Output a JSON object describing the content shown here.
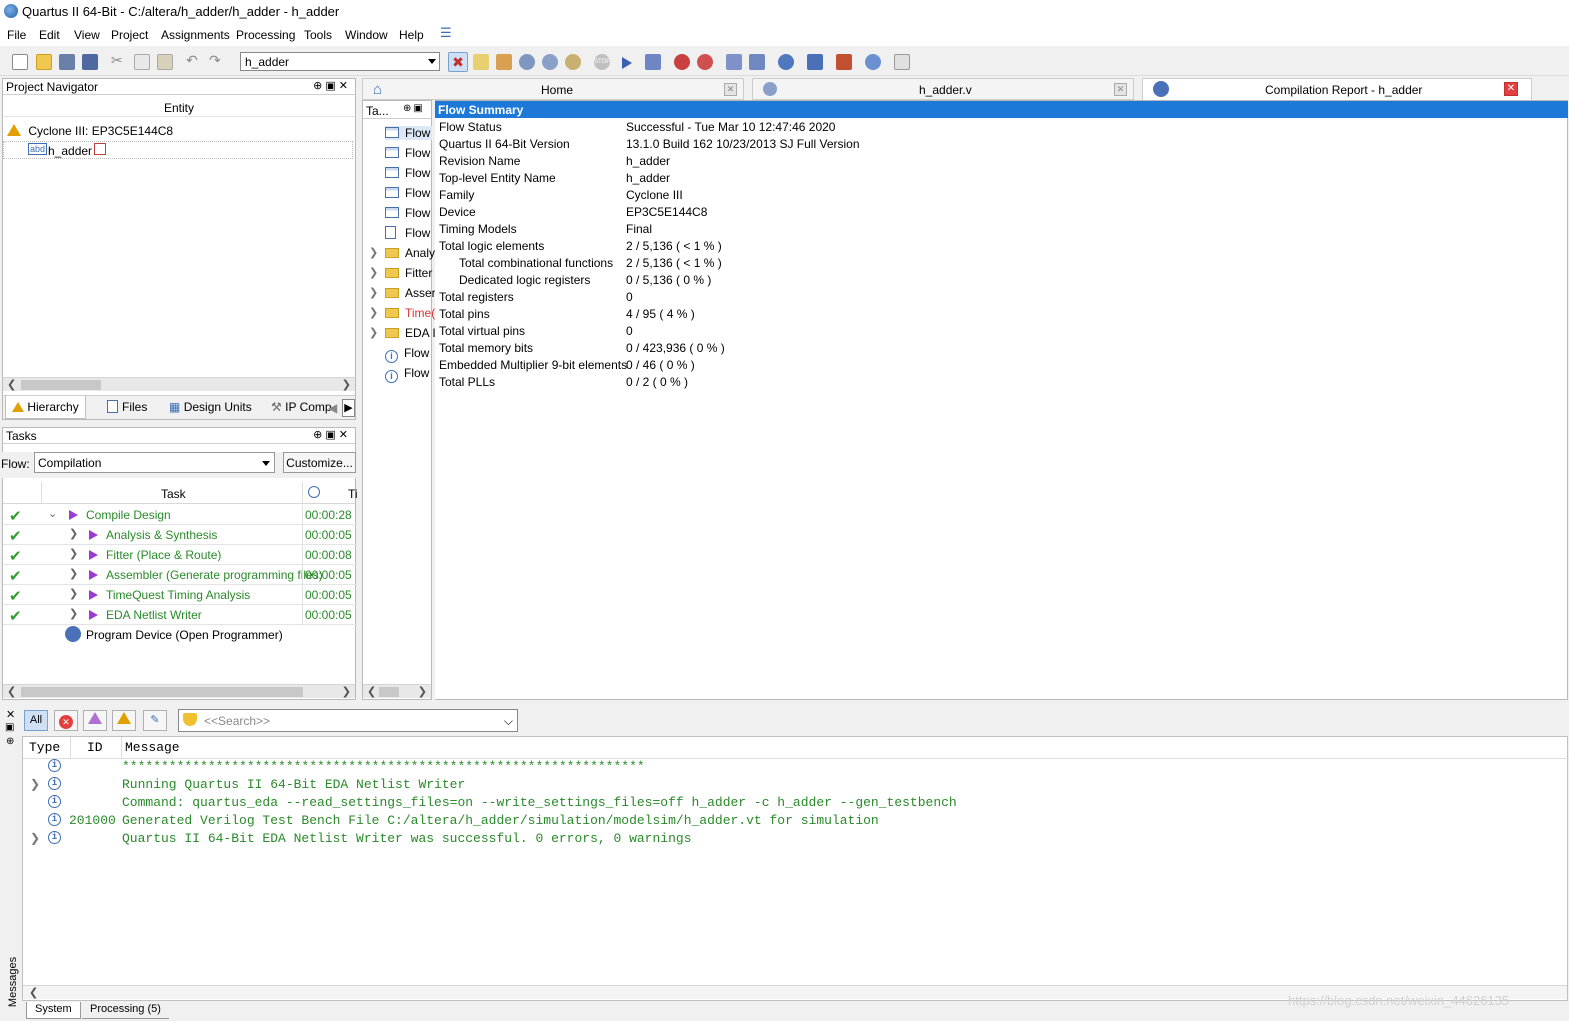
{
  "window": {
    "title": "Quartus II 64-Bit - C:/altera/h_adder/h_adder - h_adder"
  },
  "menu": [
    "File",
    "Edit",
    "View",
    "Project",
    "Assignments",
    "Processing",
    "Tools",
    "Window",
    "Help"
  ],
  "toolbar": {
    "project_select": "h_adder"
  },
  "project_navigator": {
    "title": "Project Navigator",
    "column": "Entity",
    "device": "Cyclone III: EP3C5E144C8",
    "entity": "h_adder",
    "tabs": [
      "Hierarchy",
      "Files",
      "Design Units",
      "IP Comp"
    ]
  },
  "tasks": {
    "title": "Tasks",
    "flow_label": "Flow:",
    "flow_value": "Compilation",
    "customize": "Customize...",
    "col_task": "Task",
    "col_time": "Ti",
    "rows": [
      {
        "name": "Compile Design",
        "time": "00:00:28"
      },
      {
        "name": "Analysis & Synthesis",
        "time": "00:00:05"
      },
      {
        "name": "Fitter (Place & Route)",
        "time": "00:00:08"
      },
      {
        "name": "Assembler (Generate programming files)",
        "time": "00:00:05"
      },
      {
        "name": "TimeQuest Timing Analysis",
        "time": "00:00:05"
      },
      {
        "name": "EDA Netlist Writer",
        "time": "00:00:05"
      }
    ],
    "program_device": "Program Device (Open Programmer)"
  },
  "doc_tabs": {
    "home": "Home",
    "file": "h_adder.v",
    "report": "Compilation Report - h_adder"
  },
  "report_toc": {
    "header": "Ta...",
    "items": [
      "Flow",
      "Flow",
      "Flow",
      "Flow",
      "Flow",
      "Flow",
      "Analy",
      "Fitter",
      "Asser",
      "Time(",
      "EDA I",
      "Flow",
      "Flow"
    ]
  },
  "flow_summary": {
    "title": "Flow Summary",
    "rows": [
      {
        "k": "Flow Status",
        "v": "Successful - Tue Mar 10 12:47:46 2020"
      },
      {
        "k": "Quartus II 64-Bit Version",
        "v": "13.1.0 Build 162 10/23/2013 SJ Full Version"
      },
      {
        "k": "Revision Name",
        "v": "h_adder"
      },
      {
        "k": "Top-level Entity Name",
        "v": "h_adder"
      },
      {
        "k": "Family",
        "v": "Cyclone III"
      },
      {
        "k": "Device",
        "v": "EP3C5E144C8"
      },
      {
        "k": "Timing Models",
        "v": "Final"
      },
      {
        "k": "Total logic elements",
        "v": "2 / 5,136 ( < 1 % )"
      },
      {
        "k": "Total combinational functions",
        "v": "2 / 5,136 ( < 1 % )"
      },
      {
        "k": "Dedicated logic registers",
        "v": "0 / 5,136 ( 0 % )"
      },
      {
        "k": "Total registers",
        "v": "0"
      },
      {
        "k": "Total pins",
        "v": "4 / 95 ( 4 % )"
      },
      {
        "k": "Total virtual pins",
        "v": "0"
      },
      {
        "k": "Total memory bits",
        "v": "0 / 423,936 ( 0 % )"
      },
      {
        "k": "Embedded Multiplier 9-bit elements",
        "v": "0 / 46 ( 0 % )"
      },
      {
        "k": "Total PLLs",
        "v": "0 / 2 ( 0 % )"
      }
    ]
  },
  "messages": {
    "filter_all": "All",
    "search_placeholder": "<<Search>>",
    "col_type": "Type",
    "col_id": "ID",
    "col_message": "Message",
    "rows": [
      {
        "id": "",
        "text": "*******************************************************************"
      },
      {
        "id": "",
        "text": "Running Quartus II 64-Bit EDA Netlist Writer"
      },
      {
        "id": "",
        "text": "Command: quartus_eda --read_settings_files=on --write_settings_files=off h_adder -c h_adder --gen_testbench"
      },
      {
        "id": "201000",
        "text": "Generated Verilog Test Bench File C:/altera/h_adder/simulation/modelsim/h_adder.vt for simulation"
      },
      {
        "id": "",
        "text": "Quartus II 64-Bit EDA Netlist Writer was successful. 0 errors, 0 warnings"
      }
    ],
    "side_label": "Messages",
    "bottom_tabs": [
      "System",
      "Processing (5)"
    ]
  },
  "watermark": "https://blog.csdn.net/weixin_44626135"
}
